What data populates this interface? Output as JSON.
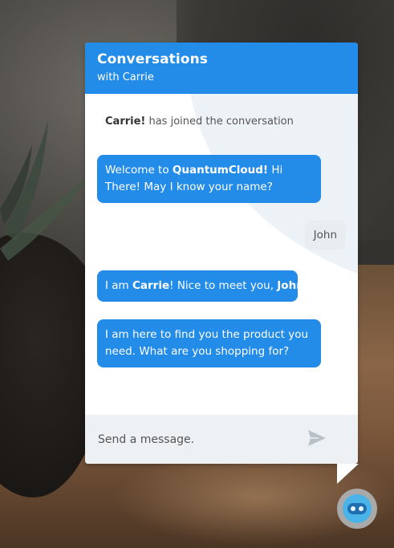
{
  "header": {
    "title": "Conversations",
    "subtitle": "with Carrie"
  },
  "messages": {
    "joined_name": "Carrie!",
    "joined_text": " has joined the conversation",
    "m1_a": "Welcome to ",
    "m1_brand": "QuantumCloud!",
    "m1_b": " Hi There! May I know your name?",
    "user_reply": "John",
    "m2_a": "I am ",
    "m2_name": "Carrie",
    "m2_b": "! Nice to meet you, ",
    "m2_user": "John",
    "m2_c": "!",
    "m3": "I am here to find you the product you need. What are you shopping for?"
  },
  "footer": {
    "input_placeholder": "Send a message.",
    "input_value": ""
  },
  "icons": {
    "send": "send-icon",
    "launcher": "bot-face-icon"
  },
  "colors": {
    "accent": "#238be8",
    "user_bubble": "#e8edf2",
    "footer_bg": "#eef1f4",
    "launcher_ring": "#a9a9a9",
    "launcher_inner": "#4ab3e8"
  }
}
